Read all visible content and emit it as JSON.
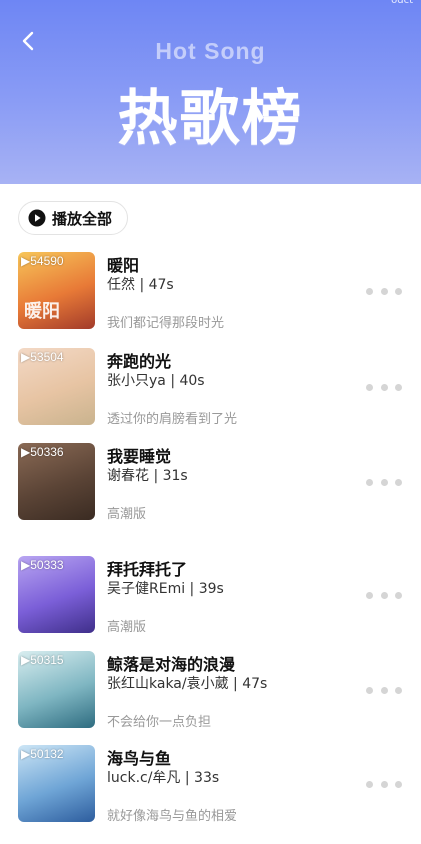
{
  "header": {
    "corner_text": "odct",
    "subtitle": "Hot Song",
    "title": "热歌榜"
  },
  "play_all": {
    "label": "播放全部"
  },
  "songs": [
    {
      "count": "54590",
      "title": "暖阳",
      "meta": "任然 | 47s",
      "desc": "我们都记得那段时光",
      "cover_text": "暖阳",
      "colors": [
        "#f7c65a",
        "#e87a37",
        "#a23b2a"
      ]
    },
    {
      "count": "53504",
      "title": "奔跑的光",
      "meta": "张小只ya | 40s",
      "desc": "透过你的肩膀看到了光",
      "cover_text": "",
      "colors": [
        "#f3d9c6",
        "#e7c4a3",
        "#c9b38e"
      ]
    },
    {
      "count": "50336",
      "title": "我要睡觉",
      "meta": "谢春花 | 31s",
      "desc": "高潮版",
      "cover_text": "",
      "colors": [
        "#8a6a55",
        "#5b4436",
        "#3a2b22"
      ]
    },
    {
      "count": "50333",
      "title": "拜托拜托了",
      "meta": "吴子健REmi | 39s",
      "desc": "高潮版",
      "cover_text": "",
      "colors": [
        "#b9a6f2",
        "#7b5fd8",
        "#3f2f8a"
      ]
    },
    {
      "count": "50315",
      "title": "鲸落是对海的浪漫",
      "meta": "张红山kaka/袁小葳 | 47s",
      "desc": "不会给你一点负担",
      "cover_text": "",
      "colors": [
        "#d9eef0",
        "#7fb6c2",
        "#2e6c80"
      ]
    },
    {
      "count": "50132",
      "title": "海鸟与鱼",
      "meta": "luck.c/牟凡 | 33s",
      "desc": "就好像海鸟与鱼的相爱",
      "cover_text": "",
      "colors": [
        "#cde6f6",
        "#6fa5d6",
        "#2d5d9e"
      ]
    }
  ]
}
